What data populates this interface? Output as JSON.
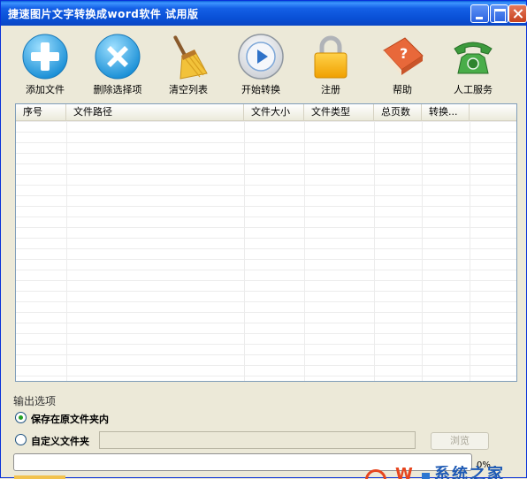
{
  "window": {
    "title": "捷速图片文字转换成word软件 试用版"
  },
  "toolbar": {
    "add": "添加文件",
    "remove": "删除选择项",
    "clear": "清空列表",
    "start": "开始转换",
    "register": "注册",
    "help": "帮助",
    "service": "人工服务"
  },
  "table": {
    "columns": [
      "序号",
      "文件路径",
      "文件大小",
      "文件类型",
      "总页数",
      "转换..."
    ]
  },
  "output": {
    "group_label": "输出选项",
    "option_keep": "保存在原文件夹内",
    "option_custom": "自定义文件夹",
    "folder_value": "",
    "browse_label": "浏览",
    "selected": "keep"
  },
  "progress": {
    "value": 0,
    "label": "0%"
  },
  "watermark": {
    "w": "W",
    "text": "系统之家"
  },
  "colors": {
    "accent": "#0a5fd8",
    "progress": "#2ba82b",
    "radio_on": "#21a121"
  }
}
